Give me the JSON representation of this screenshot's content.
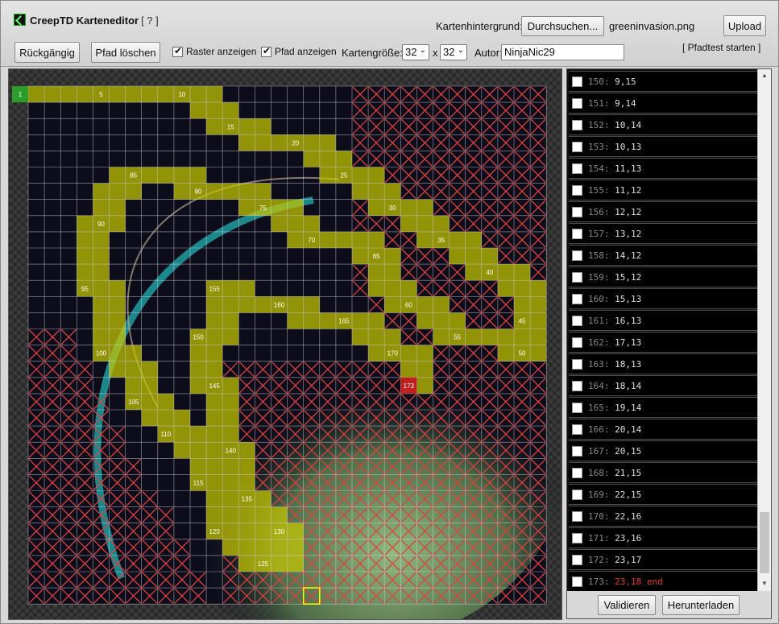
{
  "header": {
    "app_title": "CreepTD Karteneditor",
    "help_label": "[ ? ]",
    "background_label": "Kartenhintergrund:",
    "browse_button": "Durchsuchen...",
    "background_file": "greeninvasion.png",
    "upload_button": "Upload"
  },
  "toolbar": {
    "undo_button": "Rückgängig",
    "clear_path_button": "Pfad löschen",
    "show_grid_label": "Raster anzeigen",
    "show_grid_checked": true,
    "show_path_label": "Pfad anzeigen",
    "show_path_checked": true,
    "map_size_label": "Kartengröße:",
    "map_width": "32",
    "size_separator": "x",
    "map_height": "32",
    "author_label": "Autor:",
    "author_value": "NinjaNic29",
    "pathtest_link": "[ Pfadtest starten ]"
  },
  "map": {
    "cols": 32,
    "rows": 32,
    "start_label": "1",
    "end_label": "173",
    "colors": {
      "path": "#c8c800",
      "blocked_x": "#e04040",
      "grid": "#cfcfdf",
      "start": "#2a9d2a",
      "end": "#c02020",
      "space": "#0c0c1a"
    },
    "path_labels": [
      {
        "label": "5",
        "col": 4,
        "row": 0
      },
      {
        "label": "10",
        "col": 9,
        "row": 0
      },
      {
        "label": "15",
        "col": 12,
        "row": 2
      },
      {
        "label": "20",
        "col": 16,
        "row": 3
      },
      {
        "label": "25",
        "col": 19,
        "row": 5
      },
      {
        "label": "30",
        "col": 22,
        "row": 7
      },
      {
        "label": "35",
        "col": 25,
        "row": 9
      },
      {
        "label": "40",
        "col": 28,
        "row": 11
      },
      {
        "label": "45",
        "col": 30,
        "row": 14
      },
      {
        "label": "50",
        "col": 30,
        "row": 16
      },
      {
        "label": "55",
        "col": 26,
        "row": 15
      },
      {
        "label": "60",
        "col": 23,
        "row": 13
      },
      {
        "label": "65",
        "col": 21,
        "row": 10
      },
      {
        "label": "70",
        "col": 17,
        "row": 9
      },
      {
        "label": "75",
        "col": 14,
        "row": 7
      },
      {
        "label": "80",
        "col": 10,
        "row": 6
      },
      {
        "label": "85",
        "col": 6,
        "row": 5
      },
      {
        "label": "90",
        "col": 4,
        "row": 8
      },
      {
        "label": "95",
        "col": 3,
        "row": 12
      },
      {
        "label": "100",
        "col": 4,
        "row": 16
      },
      {
        "label": "105",
        "col": 6,
        "row": 19
      },
      {
        "label": "110",
        "col": 8,
        "row": 21
      },
      {
        "label": "115",
        "col": 10,
        "row": 24
      },
      {
        "label": "120",
        "col": 11,
        "row": 27
      },
      {
        "label": "125",
        "col": 14,
        "row": 29
      },
      {
        "label": "130",
        "col": 15,
        "row": 27
      },
      {
        "label": "135",
        "col": 13,
        "row": 25
      },
      {
        "label": "140",
        "col": 12,
        "row": 22
      },
      {
        "label": "145",
        "col": 11,
        "row": 18
      },
      {
        "label": "150",
        "col": 10,
        "row": 15
      },
      {
        "label": "155",
        "col": 11,
        "row": 12
      },
      {
        "label": "160",
        "col": 15,
        "row": 13
      },
      {
        "label": "165",
        "col": 19,
        "row": 14
      },
      {
        "label": "170",
        "col": 22,
        "row": 16
      }
    ]
  },
  "path_list": {
    "items": [
      {
        "index": "150:",
        "coords": "9,15"
      },
      {
        "index": "151:",
        "coords": "9,14"
      },
      {
        "index": "152:",
        "coords": "10,14"
      },
      {
        "index": "153:",
        "coords": "10,13"
      },
      {
        "index": "154:",
        "coords": "11,13"
      },
      {
        "index": "155:",
        "coords": "11,12"
      },
      {
        "index": "156:",
        "coords": "12,12"
      },
      {
        "index": "157:",
        "coords": "13,12"
      },
      {
        "index": "158:",
        "coords": "14,12"
      },
      {
        "index": "159:",
        "coords": "15,12"
      },
      {
        "index": "160:",
        "coords": "15,13"
      },
      {
        "index": "161:",
        "coords": "16,13"
      },
      {
        "index": "162:",
        "coords": "17,13"
      },
      {
        "index": "163:",
        "coords": "18,13"
      },
      {
        "index": "164:",
        "coords": "18,14"
      },
      {
        "index": "165:",
        "coords": "19,14"
      },
      {
        "index": "166:",
        "coords": "20,14"
      },
      {
        "index": "167:",
        "coords": "20,15"
      },
      {
        "index": "168:",
        "coords": "21,15"
      },
      {
        "index": "169:",
        "coords": "22,15"
      },
      {
        "index": "170:",
        "coords": "22,16"
      },
      {
        "index": "171:",
        "coords": "23,16"
      },
      {
        "index": "172:",
        "coords": "23,17"
      },
      {
        "index": "173:",
        "coords": "23,18 end"
      }
    ],
    "validate_button": "Validieren",
    "download_button": "Herunterladen"
  }
}
